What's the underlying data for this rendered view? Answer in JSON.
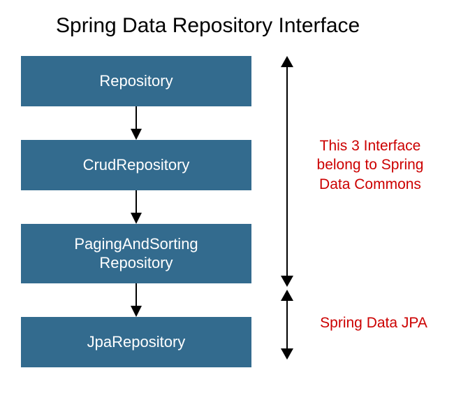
{
  "title": "Spring Data Repository Interface",
  "boxes": {
    "repository": "Repository",
    "crud": "CrudRepository",
    "paging_line1": "PagingAndSorting",
    "paging_line2": "Repository",
    "jpa": "JpaRepository"
  },
  "annotations": {
    "commons_line1": "This 3 Interface",
    "commons_line2": "belong to Spring",
    "commons_line3": "Data Commons",
    "jpa": "Spring Data JPA"
  }
}
